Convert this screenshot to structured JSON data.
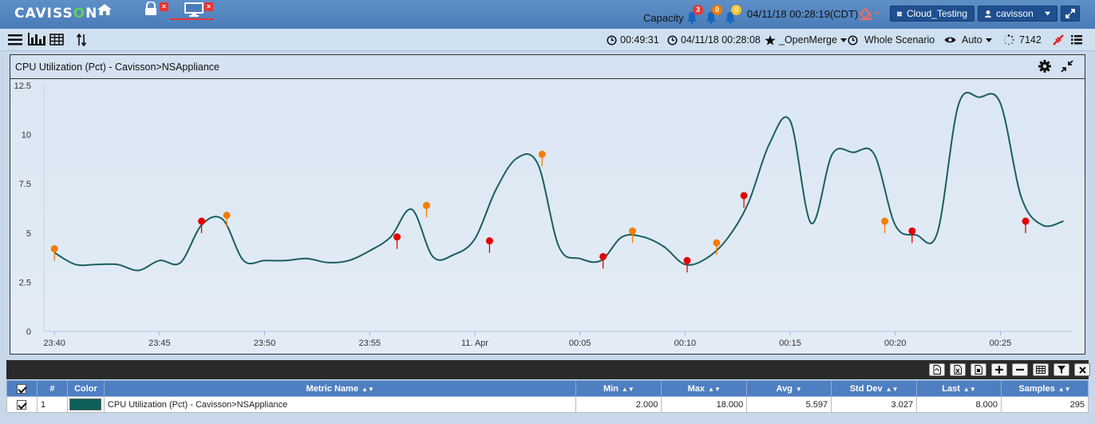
{
  "app": {
    "logo_left": "CAVISS",
    "logo_o": "O",
    "logo_right": "N",
    "capacity_label": "Capacity",
    "alerts": [
      {
        "count": "3",
        "color": "#e53935"
      },
      {
        "count": "0",
        "color": "#f57c00"
      },
      {
        "count": "0",
        "color": "#fbc02d"
      }
    ],
    "datetime": "04/11/18 00:28:19(CDT)",
    "project_button": "Cloud_Testing",
    "user_button": "cavisson",
    "accent_color": "#4a7cb8"
  },
  "toolbar": {
    "elapsed": "00:49:31",
    "end_time": "04/11/18 00:28:08",
    "favorite": "_OpenMerge",
    "scenario": "Whole Scenario",
    "view_mode": "Auto",
    "refresh_count": "7142"
  },
  "panel": {
    "title": "CPU Utilization (Pct) - Cavisson>NSAppliance"
  },
  "chart_data": {
    "type": "line",
    "title": "CPU Utilization (Pct) - Cavisson>NSAppliance",
    "xlabel": "",
    "ylabel": "",
    "ylim": [
      0,
      12.5
    ],
    "yticks": [
      "0",
      "2.5",
      "5",
      "7.5",
      "10",
      "12.5"
    ],
    "xticks": [
      "23:40",
      "23:45",
      "23:50",
      "23:55",
      "11. Apr",
      "00:05",
      "00:10",
      "00:15",
      "00:20",
      "00:25"
    ],
    "xrange_minutes": [
      -20.5,
      28.4
    ],
    "grid": false,
    "line_color": "#1b5f5d",
    "series": [
      {
        "x": [
          -20,
          -19,
          -18,
          -17,
          -16,
          -15,
          -14,
          -13,
          -12,
          -11,
          -10,
          -9,
          -8,
          -7,
          -6,
          -5,
          -4,
          -3,
          -2,
          -1,
          0,
          1,
          2,
          3,
          4,
          5,
          6,
          7,
          8,
          9,
          10,
          11,
          12,
          13,
          14,
          15,
          16,
          17,
          18,
          19,
          20,
          21,
          22,
          23,
          24,
          25,
          26,
          27,
          28
        ],
        "values": [
          4.0,
          3.4,
          3.4,
          3.4,
          3.1,
          3.6,
          3.5,
          5.4,
          5.7,
          3.6,
          3.6,
          3.6,
          3.7,
          3.5,
          3.6,
          4.1,
          4.8,
          6.2,
          3.8,
          3.9,
          4.7,
          7.2,
          8.8,
          8.5,
          4.3,
          3.7,
          3.6,
          4.8,
          4.8,
          4.3,
          3.4,
          3.7,
          4.7,
          6.5,
          9.5,
          10.7,
          5.5,
          9.0,
          9.1,
          9.0,
          5.4,
          4.9,
          5.0,
          11.5,
          11.9,
          11.6,
          6.8,
          5.4,
          5.6
        ]
      }
    ],
    "markers": [
      {
        "x": -20.0,
        "y": 4.2,
        "color": "#f57c00"
      },
      {
        "x": -13.0,
        "y": 5.6,
        "color": "#e30000"
      },
      {
        "x": -11.8,
        "y": 5.9,
        "color": "#f57c00"
      },
      {
        "x": -3.7,
        "y": 4.8,
        "color": "#e30000"
      },
      {
        "x": -2.3,
        "y": 6.4,
        "color": "#f57c00"
      },
      {
        "x": 0.7,
        "y": 4.6,
        "color": "#e30000"
      },
      {
        "x": 3.2,
        "y": 9.0,
        "color": "#f57c00"
      },
      {
        "x": 6.1,
        "y": 3.8,
        "color": "#e30000"
      },
      {
        "x": 7.5,
        "y": 5.1,
        "color": "#f57c00"
      },
      {
        "x": 10.1,
        "y": 3.6,
        "color": "#e30000"
      },
      {
        "x": 11.5,
        "y": 4.5,
        "color": "#f57c00"
      },
      {
        "x": 12.8,
        "y": 6.9,
        "color": "#e30000"
      },
      {
        "x": 19.5,
        "y": 5.6,
        "color": "#f57c00"
      },
      {
        "x": 20.8,
        "y": 5.1,
        "color": "#e30000"
      },
      {
        "x": 26.2,
        "y": 5.6,
        "color": "#e30000"
      }
    ]
  },
  "grid": {
    "columns": [
      "#",
      "Color",
      "Metric Name",
      "Min",
      "Max",
      "Avg",
      "Std Dev",
      "Last",
      "Samples"
    ],
    "rows": [
      {
        "index": "1",
        "color": "#0d5f5a",
        "metric": "CPU Utilization (Pct) - Cavisson>NSAppliance",
        "min": "2.000",
        "max": "18.000",
        "avg": "5.597",
        "std_dev": "3.027",
        "last": "8.000",
        "samples": "295"
      }
    ]
  }
}
